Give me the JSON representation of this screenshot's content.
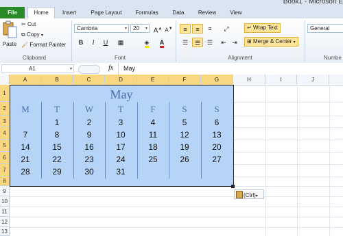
{
  "window": {
    "title": "Book1 - Microsoft E"
  },
  "tabs": [
    {
      "label": "File"
    },
    {
      "label": "Home"
    },
    {
      "label": "Insert"
    },
    {
      "label": "Page Layout"
    },
    {
      "label": "Formulas"
    },
    {
      "label": "Data"
    },
    {
      "label": "Review"
    },
    {
      "label": "View"
    }
  ],
  "ribbon": {
    "clipboard": {
      "paste": "Paste",
      "cut": "Cut",
      "copy": "Copy",
      "format_painter": "Format Painter",
      "label": "Clipboard"
    },
    "font": {
      "name": "Cambria",
      "size": "20",
      "bold": "B",
      "italic": "I",
      "underline": "U",
      "label": "Font",
      "grow": "A",
      "shrink": "A"
    },
    "alignment": {
      "wrap_text": "Wrap Text",
      "merge_center": "Merge & Center",
      "label": "Alignment"
    },
    "number": {
      "format": "General",
      "label": "Numbe"
    }
  },
  "formula_bar": {
    "name_box": "A1",
    "fx": "fx",
    "value": "May"
  },
  "columns": [
    "A",
    "B",
    "C",
    "D",
    "E",
    "F",
    "G",
    "H",
    "I",
    "J"
  ],
  "rows": [
    "1",
    "2",
    "3",
    "4",
    "5",
    "6",
    "7",
    "8",
    "9",
    "10",
    "11",
    "12",
    "13"
  ],
  "calendar": {
    "month": "May",
    "weekdays": [
      "M",
      "T",
      "W",
      "T",
      "F",
      "S",
      "S"
    ],
    "weeks": [
      [
        "",
        "1",
        "2",
        "3",
        "4",
        "5",
        "6"
      ],
      [
        "7",
        "8",
        "9",
        "10",
        "11",
        "12",
        "13"
      ],
      [
        "14",
        "15",
        "16",
        "17",
        "18",
        "19",
        "20"
      ],
      [
        "21",
        "22",
        "23",
        "24",
        "25",
        "26",
        "27"
      ],
      [
        "28",
        "29",
        "30",
        "31",
        "",
        "",
        ""
      ]
    ]
  },
  "paste_options": {
    "label": "(Ctrl)"
  },
  "colors": {
    "selection_fill": "#b6d4f7",
    "header_selected": "#f9d680",
    "month_text": "#4a6fa8",
    "file_tab": "#2a8a2a"
  }
}
